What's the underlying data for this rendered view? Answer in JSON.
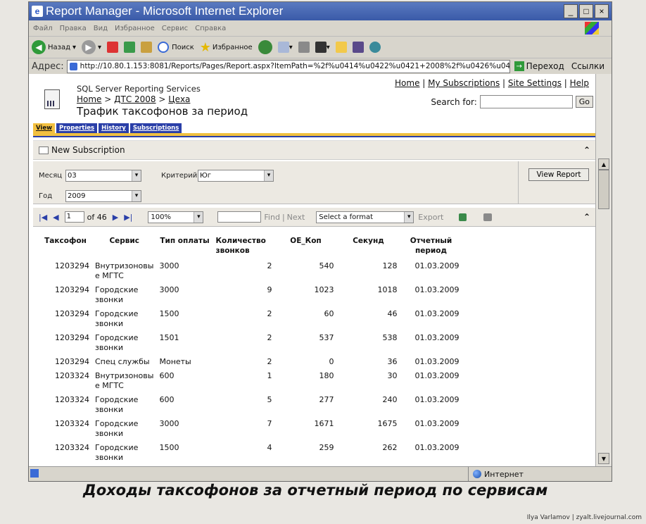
{
  "window": {
    "title": "Report Manager - Microsoft Internet Explorer"
  },
  "menubar": [
    "Файл",
    "Правка",
    "Вид",
    "Избранное",
    "Сервис",
    "Справка"
  ],
  "toolbar": {
    "back": "Назад",
    "search": "Поиск",
    "favorites": "Избранное"
  },
  "address": {
    "label": "Адрес:",
    "url": "http://10.80.1.153:8081/Reports/Pages/Report.aspx?ItemPath=%2f%u0414%u0422%u0421+2008%2f%u0426%u0435%u",
    "go": "Переход",
    "links": "Ссылки"
  },
  "header": {
    "product": "SQL Server Reporting Services",
    "breadcrumb": [
      "Home",
      "ДТС 2008",
      "Цеха"
    ],
    "title": "Трафик таксофонов за период",
    "links": [
      "Home",
      "My Subscriptions",
      "Site Settings",
      "Help"
    ],
    "search_label": "Search for:",
    "go": "Go"
  },
  "tabs": [
    "View",
    "Properties",
    "History",
    "Subscriptions"
  ],
  "new_subscription": "New Subscription",
  "params": {
    "month_label": "Месяц",
    "month_value": "03",
    "year_label": "Год",
    "year_value": "2009",
    "criteria_label": "Критерий",
    "criteria_value": "Юг",
    "view_report": "View Report"
  },
  "report_toolbar": {
    "page": "1",
    "of_pages": "of 46",
    "zoom": "100%",
    "find": "Find",
    "next": "Next",
    "format": "Select a format",
    "export": "Export"
  },
  "table": {
    "headers": [
      "Таксофон",
      "Сервис",
      "Тип оплаты",
      "Количество звонков",
      "ОЕ_Коп",
      "Секунд",
      "Отчетный период"
    ],
    "rows": [
      [
        "1203294",
        "Внутризоновы е МГТС",
        "3000",
        "2",
        "540",
        "128",
        "01.03.2009"
      ],
      [
        "1203294",
        "Городские звонки",
        "3000",
        "9",
        "1023",
        "1018",
        "01.03.2009"
      ],
      [
        "1203294",
        "Городские звонки",
        "1500",
        "2",
        "60",
        "46",
        "01.03.2009"
      ],
      [
        "1203294",
        "Городские звонки",
        "1501",
        "2",
        "537",
        "538",
        "01.03.2009"
      ],
      [
        "1203294",
        "Спец службы",
        "Монеты",
        "2",
        "0",
        "36",
        "01.03.2009"
      ],
      [
        "1203324",
        "Внутризоновы е МГТС",
        "600",
        "1",
        "180",
        "30",
        "01.03.2009"
      ],
      [
        "1203324",
        "Городские звонки",
        "600",
        "5",
        "277",
        "240",
        "01.03.2009"
      ],
      [
        "1203324",
        "Городские звонки",
        "3000",
        "7",
        "1671",
        "1675",
        "01.03.2009"
      ],
      [
        "1203324",
        "Городские звонки",
        "1500",
        "4",
        "259",
        "262",
        "01.03.2009"
      ]
    ]
  },
  "status": {
    "zone": "Интернет"
  },
  "caption": "Доходы таксофонов за отчетный период по сервисам",
  "credit": "Ilya Varlamov | zyalt.livejournal.com"
}
